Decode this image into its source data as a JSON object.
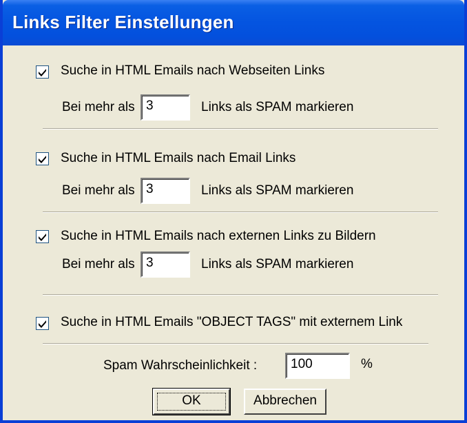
{
  "window": {
    "title": "Links Filter Einstellungen"
  },
  "sections": [
    {
      "checkbox_label": "Suche in HTML Emails nach Webseiten Links",
      "checked": true,
      "prefix": "Bei mehr als",
      "value": "3",
      "suffix": "Links als SPAM markieren"
    },
    {
      "checkbox_label": "Suche in HTML Emails nach Email Links",
      "checked": true,
      "prefix": "Bei mehr als",
      "value": "3",
      "suffix": "Links als SPAM markieren"
    },
    {
      "checkbox_label": "Suche in HTML Emails nach externen Links zu Bildern",
      "checked": true,
      "prefix": "Bei mehr als",
      "value": "3",
      "suffix": "Links als SPAM markieren"
    }
  ],
  "object_tags": {
    "checkbox_label": "Suche in HTML Emails \"OBJECT TAGS\" mit externem Link",
    "checked": true
  },
  "probability": {
    "label": "Spam Wahrscheinlichkeit :",
    "value": "100",
    "unit": "%"
  },
  "buttons": {
    "ok": "OK",
    "cancel": "Abbrechen"
  }
}
